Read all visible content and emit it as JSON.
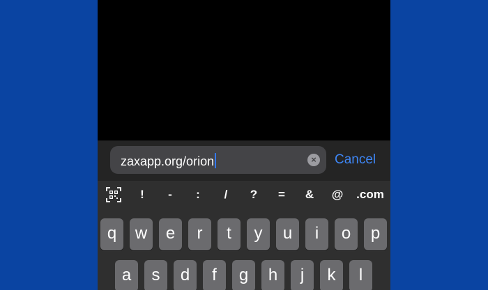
{
  "browser": {
    "url_value": "zaxapp.org/orion",
    "clear_symbol": "×",
    "cancel_label": "Cancel"
  },
  "keyboard": {
    "shortcuts": [
      "!",
      "-",
      ":",
      "/",
      "?",
      "=",
      "&",
      "@",
      ".com"
    ],
    "row1": [
      "q",
      "w",
      "e",
      "r",
      "t",
      "y",
      "u",
      "i",
      "o",
      "p"
    ],
    "row2": [
      "a",
      "s",
      "d",
      "f",
      "g",
      "h",
      "j",
      "k",
      "l"
    ]
  },
  "colors": {
    "background": "#0a44a2",
    "accent": "#3e86f5"
  }
}
